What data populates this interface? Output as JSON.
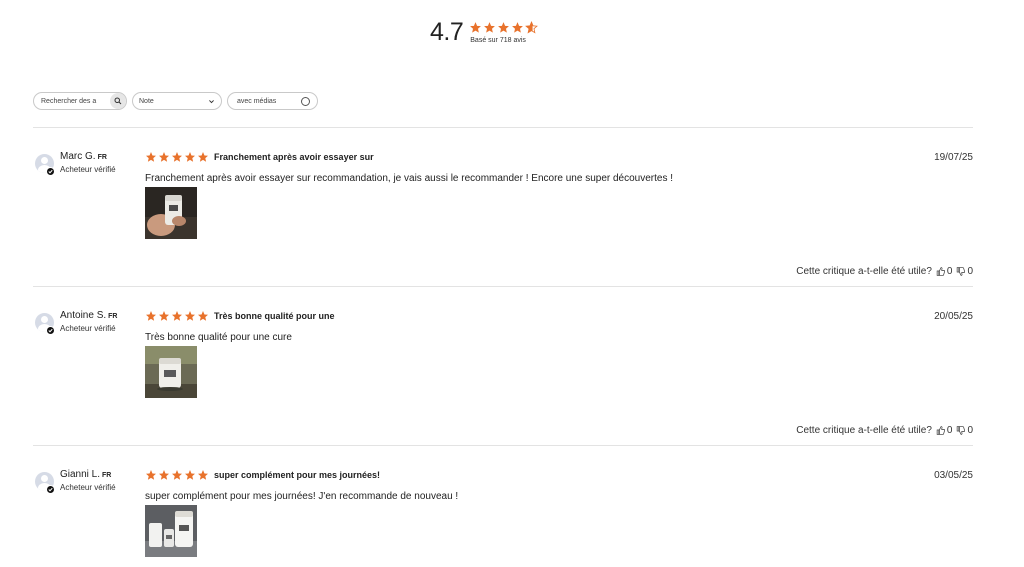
{
  "summary": {
    "average": "4.7",
    "rating_fraction": 0.94,
    "based_on": "Basé sur 718 avis"
  },
  "filters": {
    "search_placeholder": "Rechercher des a",
    "note_label": "Note",
    "media_label": "avec médias"
  },
  "colors": {
    "star": "#e8722c",
    "divider": "#e3e3e3"
  },
  "reviews": [
    {
      "author": "Marc G.",
      "country": "FR",
      "status": "Acheteur vérifié",
      "rating": 5,
      "title": "Franchement après avoir essayer sur",
      "date": "19/07/25",
      "body": "Franchement après avoir essayer sur recommandation, je vais aussi le recommander ! Encore une super découvertes !",
      "helpful_label": "Cette critique a-t-elle été utile?",
      "up": "0",
      "down": "0"
    },
    {
      "author": "Antoine S.",
      "country": "FR",
      "status": "Acheteur vérifié",
      "rating": 5,
      "title": "Très bonne qualité pour une",
      "date": "20/05/25",
      "body": "Très bonne qualité pour une cure",
      "helpful_label": "Cette critique a-t-elle été utile?",
      "up": "0",
      "down": "0"
    },
    {
      "author": "Gianni L.",
      "country": "FR",
      "status": "Acheteur vérifié",
      "rating": 5,
      "title": "super complément pour mes journées!",
      "date": "03/05/25",
      "body": "super complément pour mes journées! J'en recommande de nouveau !"
    }
  ]
}
